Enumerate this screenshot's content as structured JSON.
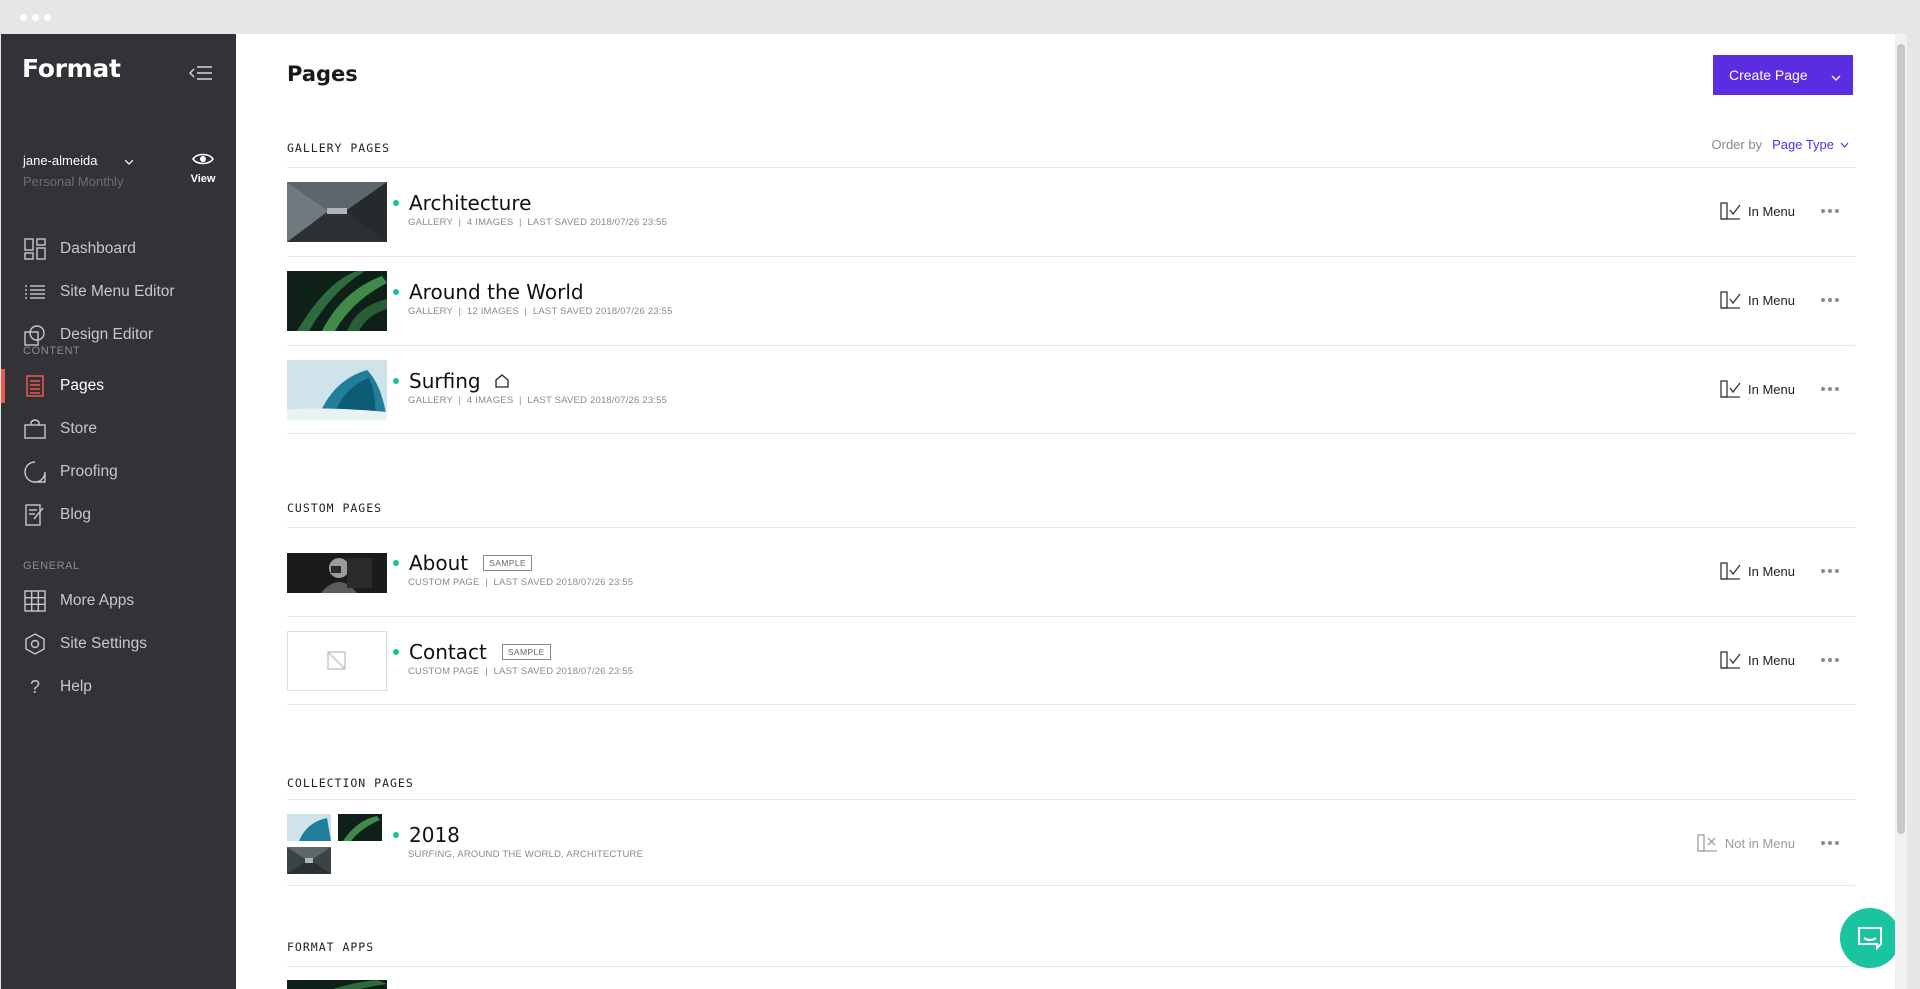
{
  "sidebar": {
    "logo": "Format",
    "account": {
      "username": "jane-almeida",
      "plan": "Personal Monthly",
      "view_label": "View"
    },
    "items_top": [
      {
        "label": "Dashboard",
        "icon": "dashboard-icon"
      },
      {
        "label": "Site Menu Editor",
        "icon": "list-icon"
      },
      {
        "label": "Design Editor",
        "icon": "design-icon"
      }
    ],
    "section_content": "CONTENT",
    "items_content": [
      {
        "label": "Pages",
        "icon": "pages-icon",
        "active": true
      },
      {
        "label": "Store",
        "icon": "bag-icon"
      },
      {
        "label": "Proofing",
        "icon": "proofing-icon"
      },
      {
        "label": "Blog",
        "icon": "blog-icon"
      }
    ],
    "section_general": "GENERAL",
    "items_general": [
      {
        "label": "More Apps",
        "icon": "grid-icon"
      },
      {
        "label": "Site Settings",
        "icon": "settings-icon"
      },
      {
        "label": "Help",
        "icon": "help-icon"
      }
    ]
  },
  "main": {
    "title": "Pages",
    "create_button": "Create Page",
    "order_by_label": "Order by",
    "order_by_value": "Page Type",
    "sections": {
      "gallery": "GALLERY PAGES",
      "custom": "CUSTOM PAGES",
      "collection": "COLLECTION PAGES",
      "apps": "FORMAT APPS"
    },
    "gallery_pages": [
      {
        "title": "Architecture",
        "meta": "GALLERY  |  4 IMAGES  |  LAST SAVED 2018/07/26 23:55",
        "menu": "In Menu"
      },
      {
        "title": "Around the World",
        "meta": "GALLERY  |  12 IMAGES  |  LAST SAVED 2018/07/26 23:55",
        "menu": "In Menu"
      },
      {
        "title": "Surfing",
        "meta": "GALLERY  |  4 IMAGES  |  LAST SAVED 2018/07/26 23:55",
        "menu": "In Menu"
      }
    ],
    "custom_pages": [
      {
        "title": "About",
        "badge": "SAMPLE",
        "meta": "CUSTOM PAGE  |  LAST SAVED 2018/07/26 23:55",
        "menu": "In Menu"
      },
      {
        "title": "Contact",
        "badge": "SAMPLE",
        "meta": "CUSTOM PAGE  |  LAST SAVED 2018/07/26 23:55",
        "menu": "In Menu"
      }
    ],
    "collection_pages": [
      {
        "title": "2018",
        "meta": "SURFING, AROUND THE WORLD, ARCHITECTURE",
        "menu": "Not in Menu"
      }
    ]
  },
  "colors": {
    "sidebar_bg": "#333236",
    "accent": "#5a2ee0",
    "active_marker": "#ec5a4e",
    "status_dot": "#19c39a",
    "chat": "#1bc4a0"
  }
}
